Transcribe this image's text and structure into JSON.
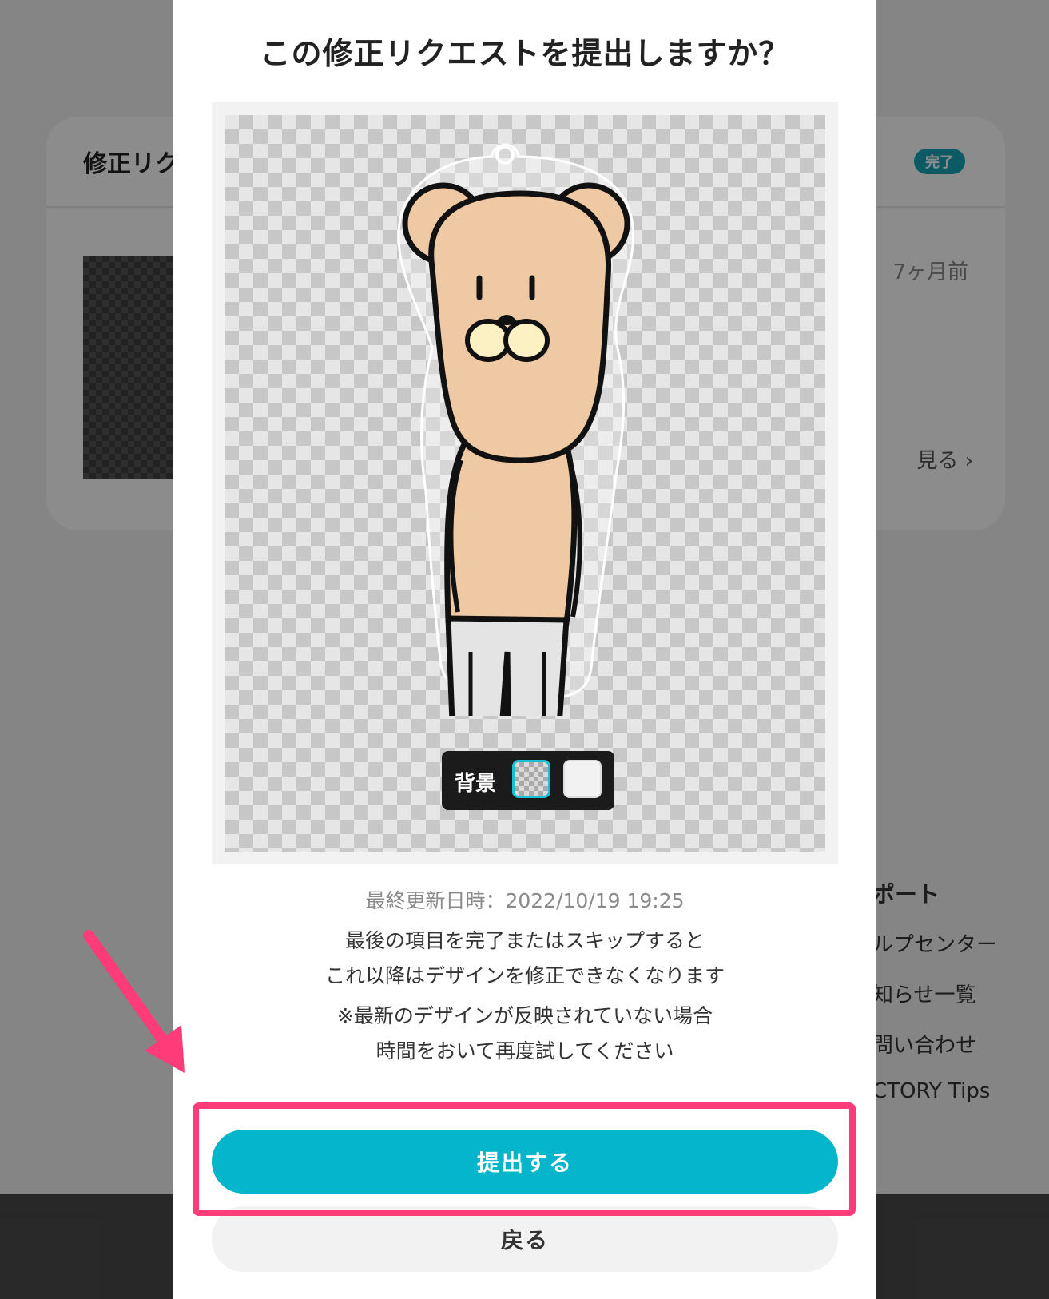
{
  "background_page": {
    "card_title": "修正リク",
    "status_badge": "完了",
    "timestamp": "7ヶ月前",
    "view_more": "見る",
    "support": {
      "title": "ポート",
      "items": [
        "ルプセンター",
        "知らせ一覧",
        "問い合わせ",
        "CTORY Tips"
      ]
    }
  },
  "modal": {
    "title": "この修正リクエストを提出しますか？",
    "background_toggle": {
      "label": "背景",
      "options": [
        "checker",
        "white"
      ],
      "selected": "checker"
    },
    "last_updated": "最終更新日時：2022/10/19 19:25",
    "notice_lines": [
      "最後の項目を完了またはスキップすると",
      "これ以降はデザインを修正できなくなります"
    ],
    "caution_lines": [
      "※最新のデザインが反映されていない場合",
      "時間をおいて再度試してください"
    ],
    "submit_label": "提出する",
    "back_label": "戻る"
  },
  "colors": {
    "accent": "#05b5cb",
    "highlight": "#ff3b7a",
    "bear_fur": "#efc9a3",
    "bear_shoes": "#b5560e",
    "pants": "#e4e4e4"
  }
}
